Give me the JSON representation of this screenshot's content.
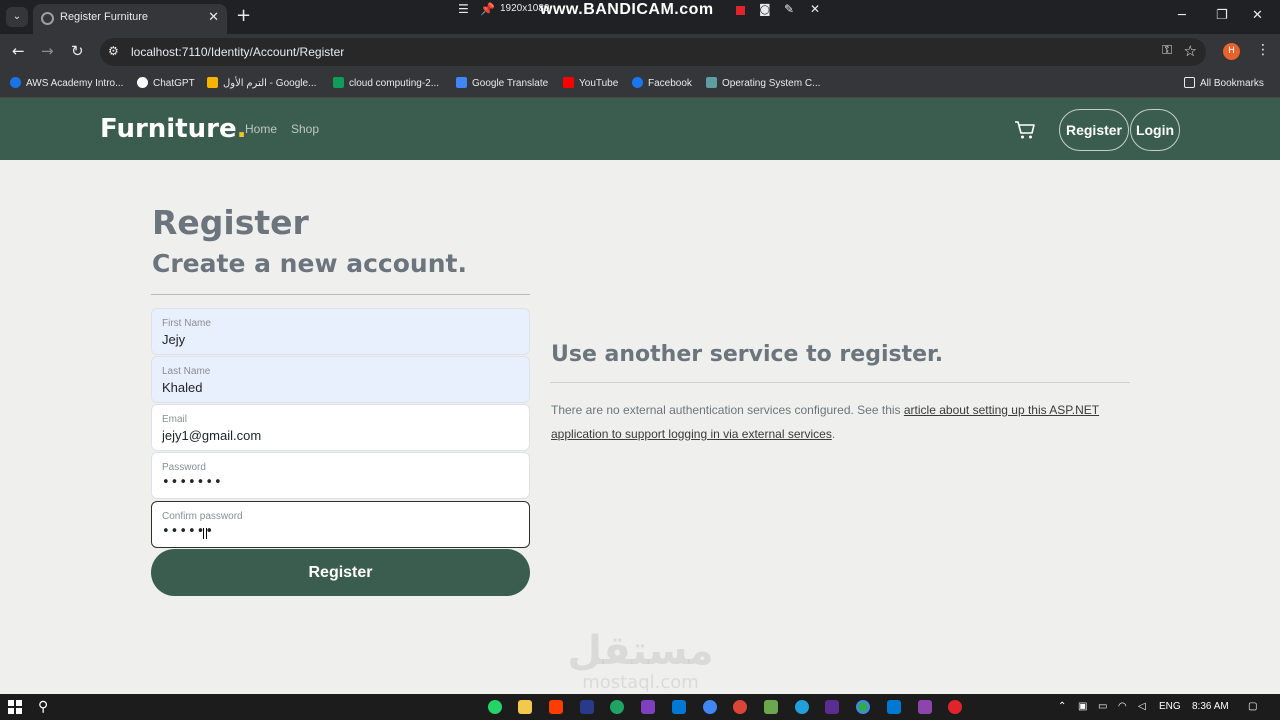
{
  "browser": {
    "tab_title": "Register Furniture",
    "url": "localhost:7110/Identity/Account/Register",
    "profile_initial": "H",
    "bookmarks": [
      {
        "label": "AWS Academy Intro...",
        "color": "#1a73e8"
      },
      {
        "label": "ChatGPT",
        "color": "#ffffff"
      },
      {
        "label": "الترم الأول - Google...",
        "color": "#f4b400"
      },
      {
        "label": "cloud computing-2...",
        "color": "#f4b400"
      },
      {
        "label": "Google Translate",
        "color": "#4285f4"
      },
      {
        "label": "YouTube",
        "color": "#ff0000"
      },
      {
        "label": "Facebook",
        "color": "#1877f2"
      },
      {
        "label": "Operating System C...",
        "color": "#5f9ea0"
      }
    ],
    "all_bookmarks": "All Bookmarks"
  },
  "recorder": {
    "resolution": "1920x1080",
    "brand": "www.BANDICAM.com"
  },
  "site": {
    "brand": "Furniture",
    "brand_dot": ".",
    "nav": [
      "Home",
      "Shop"
    ],
    "register_label": "Register",
    "login_label": "Login"
  },
  "page": {
    "title": "Register",
    "subtitle": "Create a new account.",
    "fields": {
      "first_name": {
        "label": "First Name",
        "value": "Jejy"
      },
      "last_name": {
        "label": "Last Name",
        "value": "Khaled"
      },
      "email": {
        "label": "Email",
        "value": "jejy1@gmail.com"
      },
      "password": {
        "label": "Password",
        "value": "•••••••"
      },
      "confirm": {
        "label": "Confirm password",
        "value": "••••••"
      }
    },
    "submit_label": "Register",
    "external": {
      "title": "Use another service to register.",
      "text_before": "There are no external authentication services configured. See this ",
      "link_text": "article about setting up this ASP.NET application to support logging in via external services",
      "text_after": "."
    }
  },
  "watermark": {
    "arabic": "مستقل",
    "latin": "mostaql.com"
  },
  "taskbar": {
    "language": "ENG",
    "time": "8:36 AM"
  }
}
